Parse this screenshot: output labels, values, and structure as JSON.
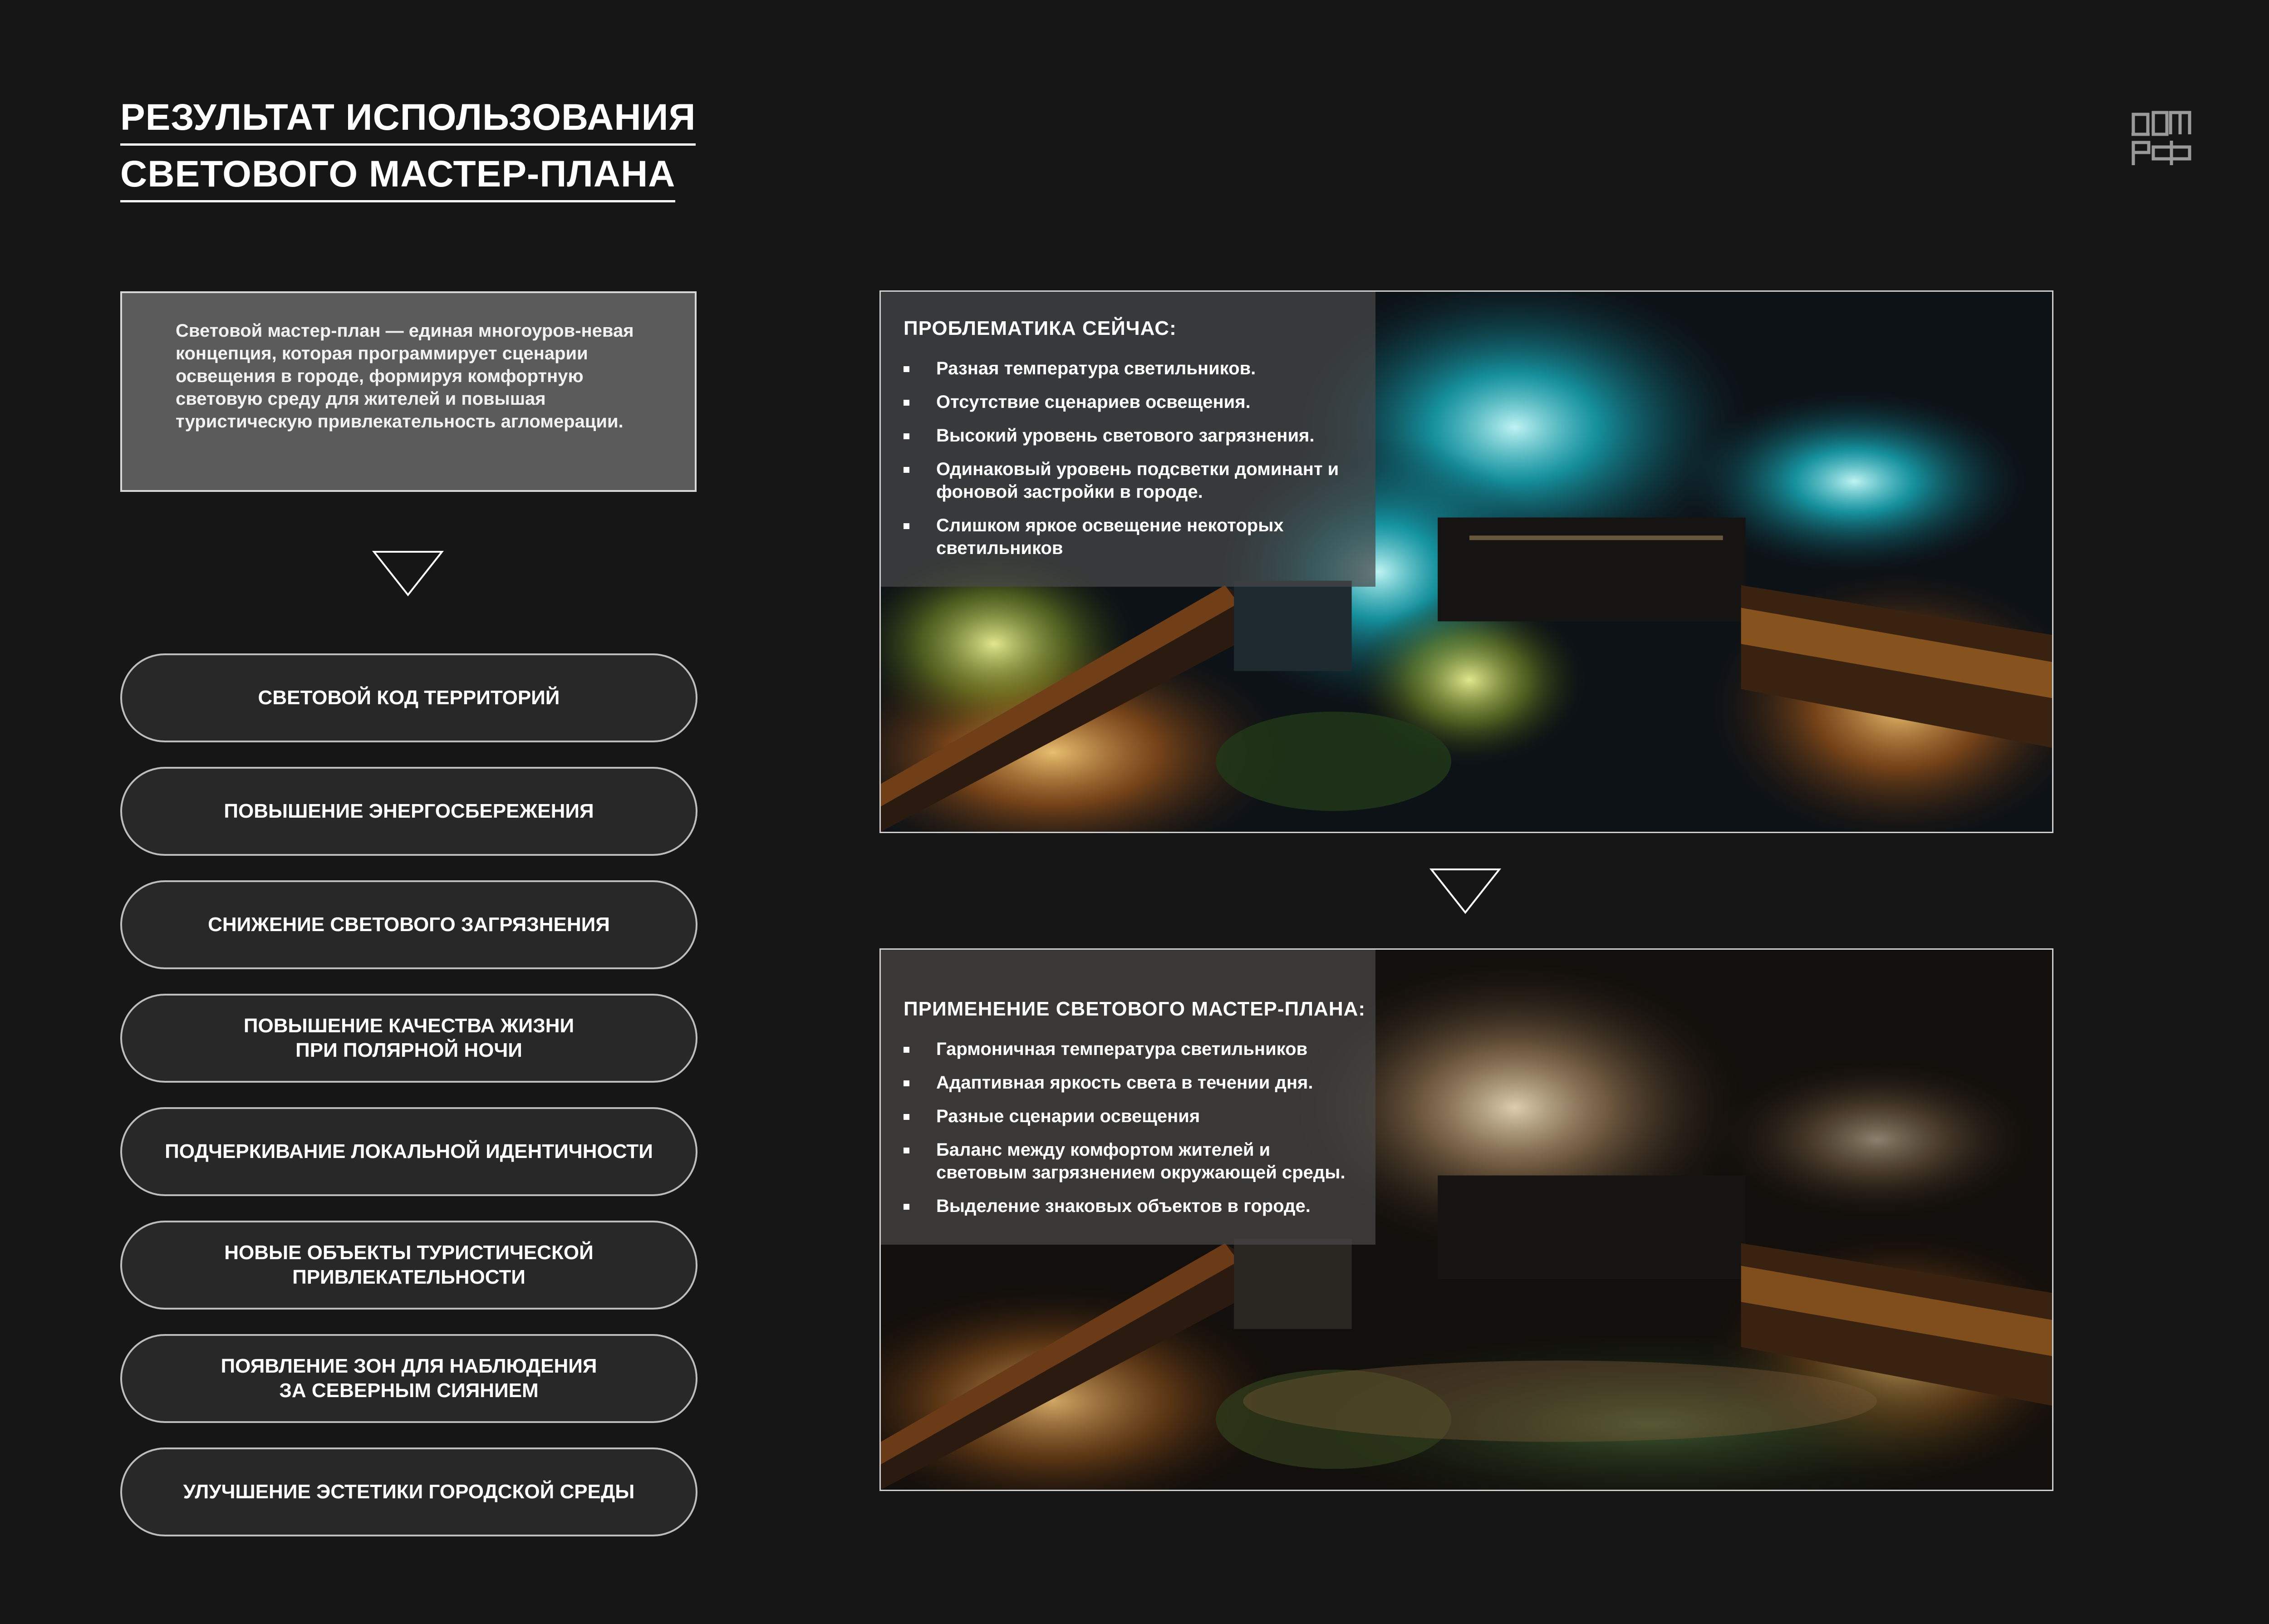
{
  "title": {
    "line1": "РЕЗУЛЬТАТ ИСПОЛЬЗОВАНИЯ",
    "line2": "СВЕТОВОГО МАСТЕР-ПЛАНА"
  },
  "logo": {
    "icon": "dom-rf-logo",
    "text": "ДОМ РФ"
  },
  "definition": "Световой мастер-план — единая многоуров-невая концепция, которая программирует сценарии освещения в городе, формируя комфортную световую среду для жителей и повышая туристическую привлекательность агломерации.",
  "icons": {
    "arrow": "triangle-down-icon"
  },
  "results": [
    "СВЕТОВОЙ КОД ТЕРРИТОРИЙ",
    "ПОВЫШЕНИЕ ЭНЕРГОСБЕРЕЖЕНИЯ",
    "СНИЖЕНИЕ СВЕТОВОГО ЗАГРЯЗНЕНИЯ",
    "ПОВЫШЕНИЕ КАЧЕСТВА ЖИЗНИ\nПРИ ПОЛЯРНОЙ НОЧИ",
    "ПОДЧЕРКИВАНИЕ ЛОКАЛЬНОЙ ИДЕНТИЧНОСТИ",
    "НОВЫЕ ОБЪЕКТЫ ТУРИСТИЧЕСКОЙ\nПРИВЛЕКАТЕЛЬНОСТИ",
    "ПОЯВЛЕНИЕ ЗОН ДЛЯ НАБЛЮДЕНИЯ\nЗА СЕВЕРНЫМ СИЯНИЕМ",
    "УЛУЧШЕНИЕ ЭСТЕТИКИ ГОРОДСКОЙ СРЕДЫ"
  ],
  "panel_now": {
    "heading": "ПРОБЛЕМАТИКА СЕЙЧАС:",
    "items": [
      "Разная температура светильников.",
      "Отсутствие сценариев освещения.",
      "Высокий уровень светового загрязнения.",
      "Одинаковый уровень подсветки доминант и фоновой застройки в городе.",
      "Слишком яркое освещение некоторых светильников"
    ]
  },
  "panel_after": {
    "heading": "ПРИМЕНЕНИЕ СВЕТОВОГО МАСТЕР-ПЛАНА:",
    "items": [
      "Гармоничная температура светильников",
      "Адаптивная яркость света в течении дня.",
      "Разные сценарии освещения",
      "Баланс между комфортом жителей и световым загрязнением окружающей среды.",
      "Выделение знаковых объектов в городе."
    ]
  },
  "colors": {
    "background": "#161616",
    "definition_box": "#5b5b5b",
    "pill_fill": "#282828",
    "pill_border": "#bdbdbd",
    "text": "#ffffff"
  }
}
